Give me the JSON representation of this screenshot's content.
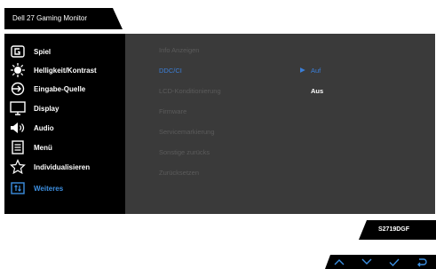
{
  "window": {
    "title": "Dell 27 Gaming Monitor"
  },
  "sidebar": {
    "items": [
      {
        "label": "Spiel",
        "icon": "game-icon"
      },
      {
        "label": "Helligkeit/Kontrast",
        "icon": "brightness-icon"
      },
      {
        "label": "Eingabe-Quelle",
        "icon": "input-source-icon"
      },
      {
        "label": "Display",
        "icon": "display-icon"
      },
      {
        "label": "Audio",
        "icon": "speaker-icon"
      },
      {
        "label": "Menü",
        "icon": "menu-icon"
      },
      {
        "label": "Individualisieren",
        "icon": "star-icon"
      },
      {
        "label": "Weiteres",
        "icon": "others-icon"
      }
    ],
    "active_index": 7
  },
  "submenu": {
    "items": [
      {
        "label": "Info Anzeigen"
      },
      {
        "label": "DDC/CI"
      },
      {
        "label": "LCD-Konditionierung"
      },
      {
        "label": "Firmware"
      },
      {
        "label": "Servicemarkierung"
      },
      {
        "label": "Sonstige zurücks"
      },
      {
        "label": "Zurücksetzen"
      }
    ],
    "active_index": 1
  },
  "options": {
    "items": [
      {
        "label": "Auf",
        "selected": true
      },
      {
        "label": "Aus",
        "selected": false
      }
    ]
  },
  "model": {
    "label": "S2719DGF"
  },
  "buttons": [
    {
      "icon": "up-arrow-icon"
    },
    {
      "icon": "down-arrow-icon"
    },
    {
      "icon": "checkmark-icon"
    },
    {
      "icon": "back-icon"
    }
  ],
  "colors": {
    "osd_background": "#000000",
    "panel_background": "#3a3a3a",
    "accent": "#3b7fd8",
    "inactive_text": "#5b5b5b",
    "text": "#ffffff"
  }
}
